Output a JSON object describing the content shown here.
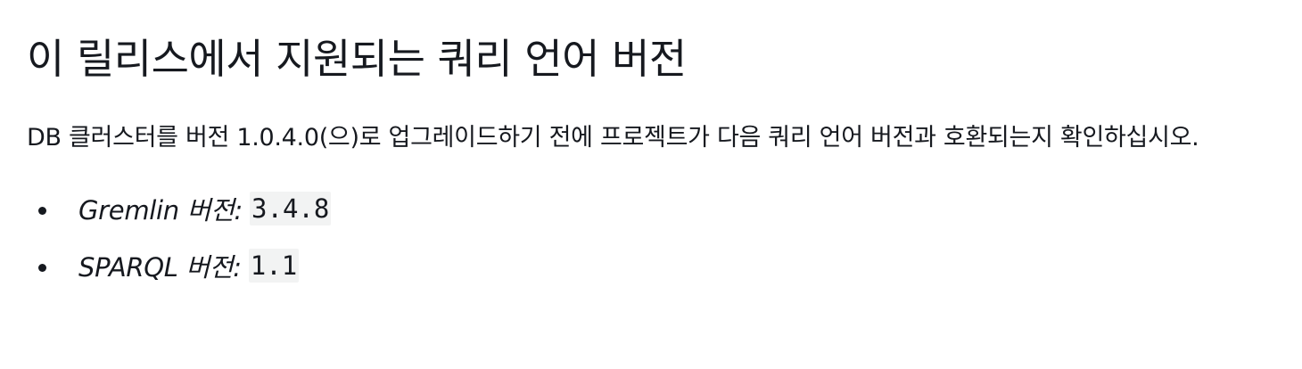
{
  "heading": "이 릴리스에서 지원되는 쿼리 언어 버전",
  "intro": "DB 클러스터를 버전 1.0.4.0(으)로 업그레이드하기 전에 프로젝트가 다음 쿼리 언어 버전과 호환되는지 확인하십시오.",
  "versions": [
    {
      "label": "Gremlin 버전:",
      "value": "3.4.8"
    },
    {
      "label": "SPARQL 버전:",
      "value": "1.1"
    }
  ]
}
